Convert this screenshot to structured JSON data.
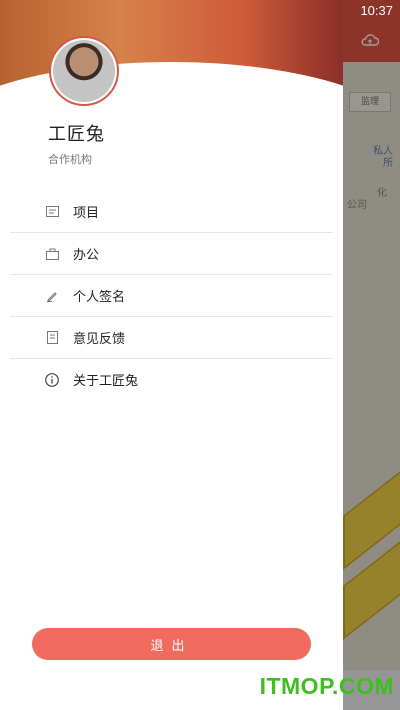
{
  "status": {
    "time": "10:37"
  },
  "drawer": {
    "user": {
      "name": "工匠兔",
      "org": "合作机构"
    },
    "menu": [
      {
        "label": "项目",
        "icon": "project-icon"
      },
      {
        "label": "办公",
        "icon": "office-icon"
      },
      {
        "label": "个人签名",
        "icon": "pen-icon"
      },
      {
        "label": "意见反馈",
        "icon": "feedback-icon"
      },
      {
        "label": "关于工匠兔",
        "icon": "info-icon"
      }
    ],
    "logout_label": "退出"
  },
  "background_map": {
    "poi_box": "监理",
    "poi_1": "私人",
    "poi_2": "所",
    "poi_3": "化",
    "poi_4": "公司"
  },
  "watermark": "ITMOP.COM",
  "colors": {
    "accent": "#f06a5e",
    "header": "#e2553f",
    "watermark": "#3fbf1f"
  }
}
